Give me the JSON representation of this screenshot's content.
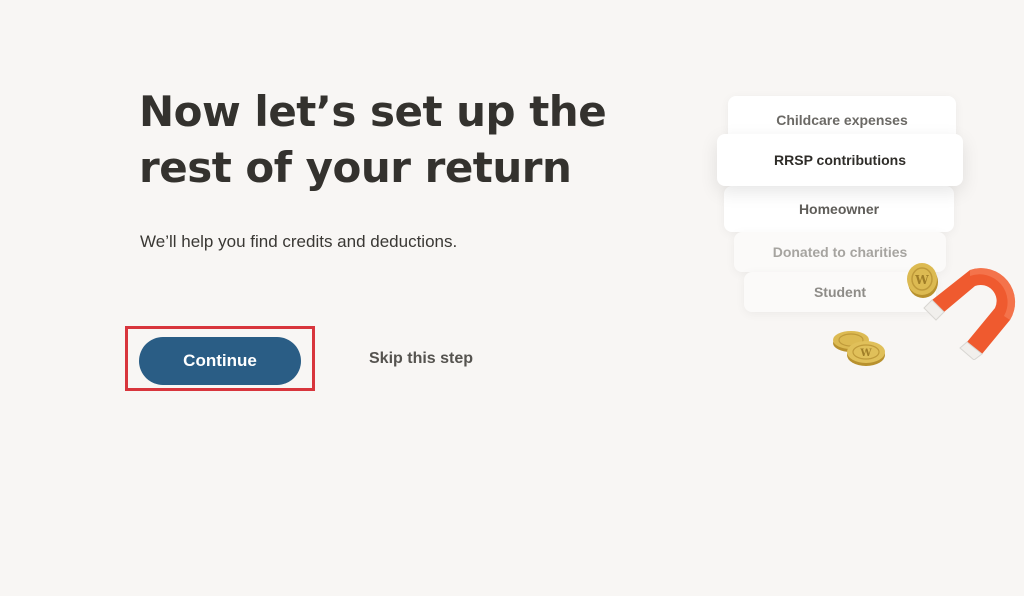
{
  "main": {
    "headline": "Now let’s set up the rest of your return",
    "subtext": "We’ll help you find credits and deductions.",
    "continue_label": "Continue",
    "skip_label": "Skip this step"
  },
  "illustration": {
    "cards": [
      "Childcare expenses",
      "RRSP contributions",
      "Homeowner",
      "Donated to charities",
      "Student"
    ],
    "icons": [
      "magnet-icon",
      "coin-icon"
    ],
    "coin_letter": "W"
  },
  "colors": {
    "background": "#f8f6f4",
    "primary_button": "#2a5d85",
    "highlight": "#d8353c",
    "magnet": "#ef5a2f",
    "coin": "#d9b54a"
  }
}
